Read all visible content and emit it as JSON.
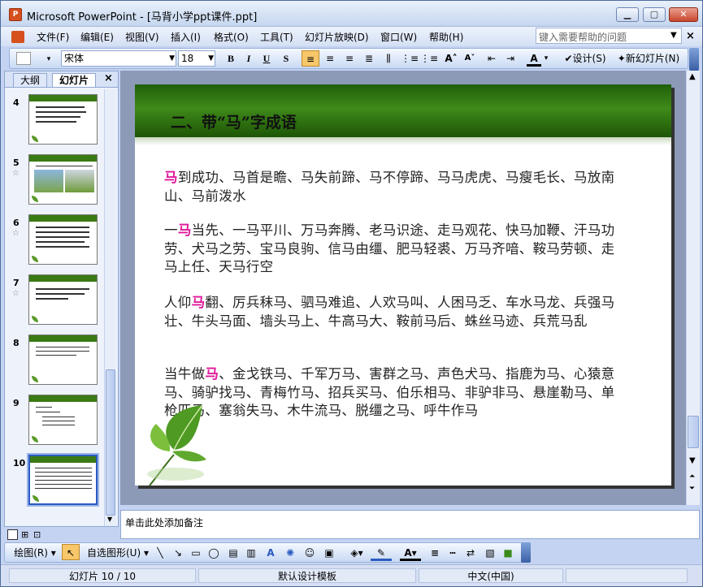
{
  "window": {
    "title": "Microsoft PowerPoint - [马背小学ppt课件.ppt]",
    "app_icon": "powerpoint-icon"
  },
  "menu": [
    "文件(F)",
    "编辑(E)",
    "视图(V)",
    "插入(I)",
    "格式(O)",
    "工具(T)",
    "幻灯片放映(D)",
    "窗口(W)",
    "帮助(H)"
  ],
  "help": {
    "placeholder": "键入需要帮助的问题"
  },
  "format_toolbar": {
    "font": "宋体",
    "size": "18",
    "bold": "B",
    "italic": "I",
    "underline": "U",
    "shadow": "S",
    "design": "设计(S)",
    "new_slide": "新幻灯片(N)"
  },
  "left_pane": {
    "tabs": [
      "大纲",
      "幻灯片"
    ],
    "close": "×",
    "slides": [
      {
        "number": "4",
        "star": ""
      },
      {
        "number": "5",
        "star": "☆"
      },
      {
        "number": "6",
        "star": "☆"
      },
      {
        "number": "7",
        "star": "☆"
      },
      {
        "number": "8",
        "star": ""
      },
      {
        "number": "9",
        "star": ""
      },
      {
        "number": "10",
        "star": ""
      }
    ],
    "selected": "10"
  },
  "slide": {
    "title": "二、带“马”字成语",
    "paragraphs": [
      {
        "highlight": "马",
        "before": "",
        "after": "到成功、马首是瞻、马失前蹄、马不停蹄、马马虎虎、马瘦毛长、马放南山、马前泼水"
      },
      {
        "before": "一",
        "highlight": "马",
        "after": "当先、一马平川、万马奔腾、老马识途、走马观花、快马加鞭、汗马功劳、犬马之劳、宝马良驹、信马由缰、肥马轻裘、万马齐喑、鞍马劳顿、走马上任、天马行空"
      },
      {
        "before": "人仰",
        "highlight": "马",
        "after": "翻、厉兵秣马、驷马难追、人欢马叫、人困马乏、车水马龙、兵强马壮、牛头马面、墙头马上、牛高马大、鞍前马后、蛛丝马迹、兵荒马乱"
      },
      {
        "before": "当牛做",
        "highlight": "马",
        "after": "、金戈铁马、千军万马、害群之马、声色犬马、指鹿为马、心猿意马、骑驴找马、青梅竹马、招兵买马、伯乐相马、非驴非马、悬崖勒马、单枪匹马、塞翁失马、木牛流马、脱缰之马、呼牛作马"
      }
    ],
    "colors": {
      "header_green": "#2d6e0f",
      "highlight": "#e0179a"
    }
  },
  "notes": {
    "placeholder": "单击此处添加备注"
  },
  "draw_toolbar": {
    "draw": "绘图(R)",
    "autoshape": "自选图形(U)"
  },
  "status": {
    "slide": "幻灯片 10 / 10",
    "template": "默认设计模板",
    "language": "中文(中国)"
  }
}
